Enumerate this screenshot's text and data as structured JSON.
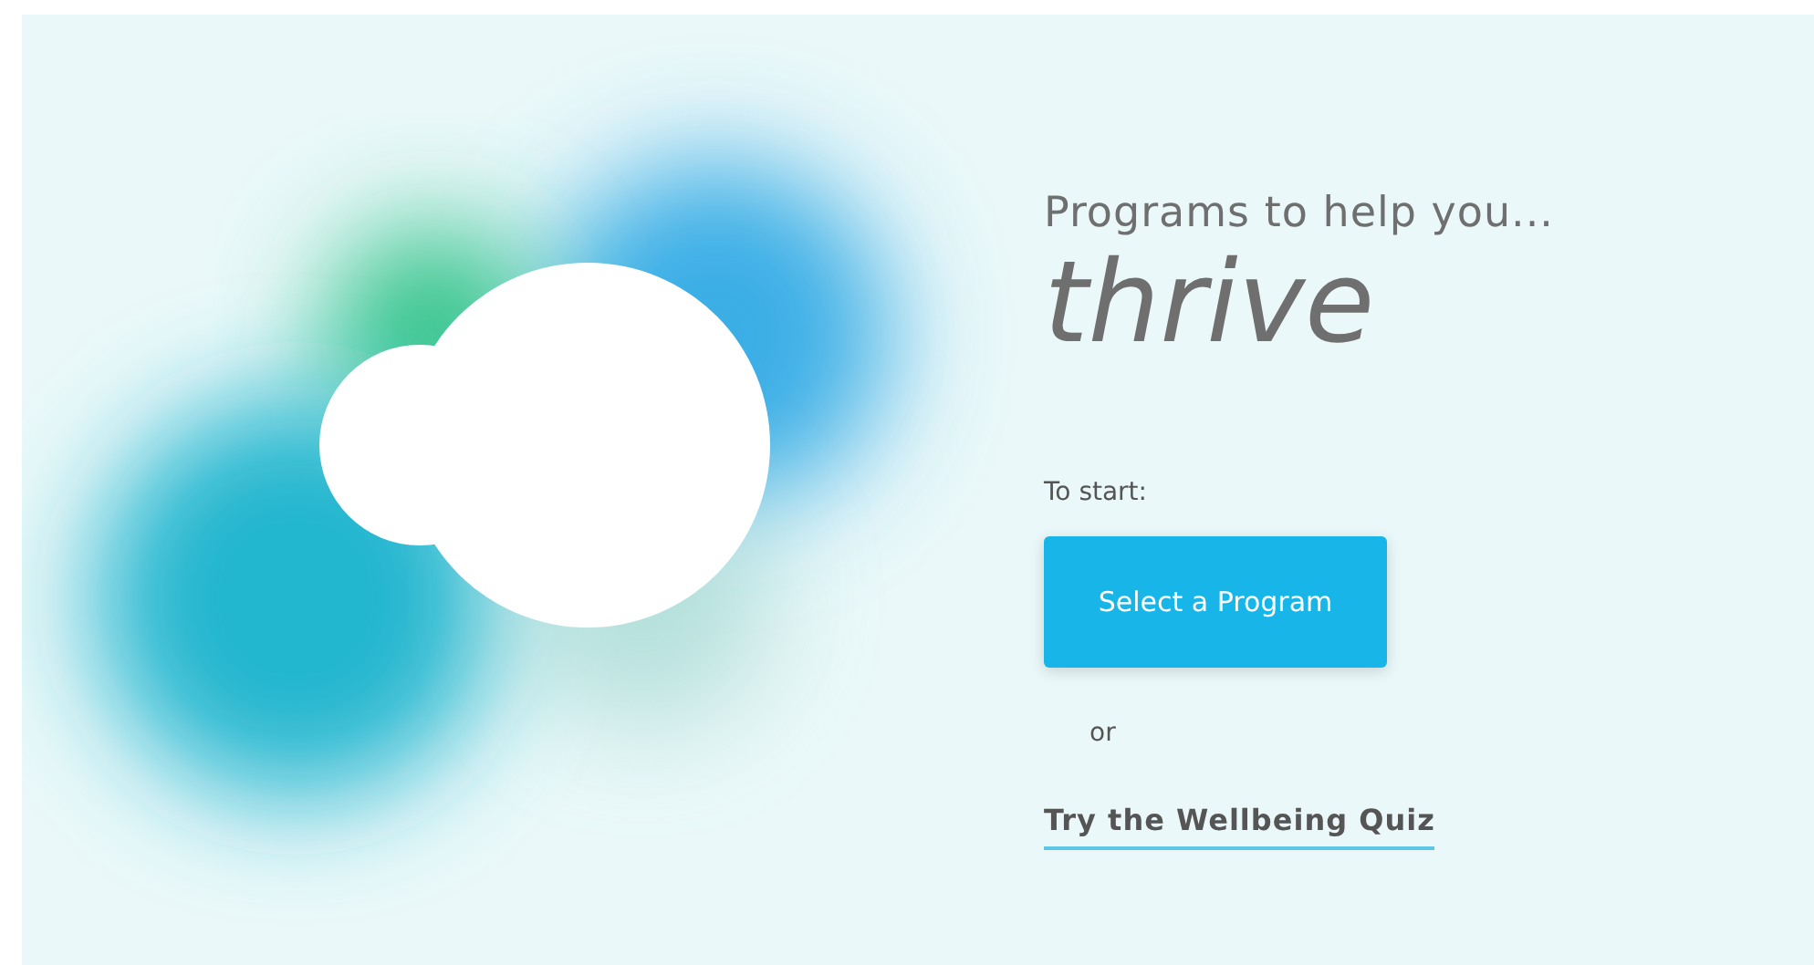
{
  "hero": {
    "intro": "Programs to help you...",
    "headline": "thrive",
    "prompt": "To start:",
    "primary_button": "Select a Program",
    "separator": "or",
    "quiz_link": "Try the Wellbeing Quiz"
  }
}
